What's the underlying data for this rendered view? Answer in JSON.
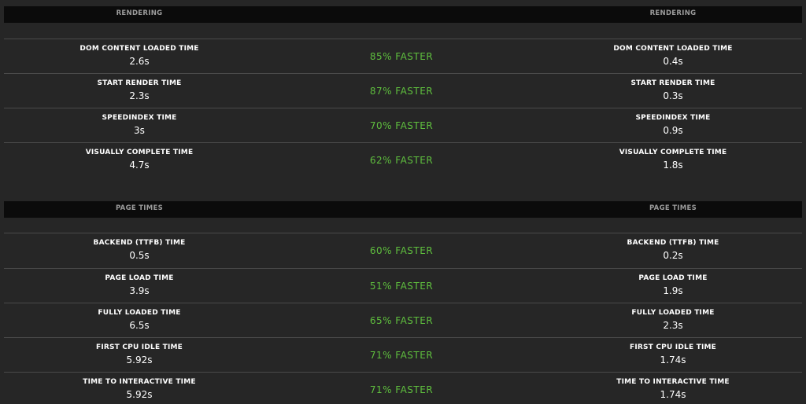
{
  "rendering": {
    "header_left": "RENDERING",
    "header_right": "RENDERING",
    "rows": [
      {
        "label": "DOM CONTENT LOADED TIME",
        "before": "2.6s",
        "after": "0.4s",
        "delta": "85% FASTER"
      },
      {
        "label": "START RENDER TIME",
        "before": "2.3s",
        "after": "0.3s",
        "delta": "87% FASTER"
      },
      {
        "label": "SPEEDINDEX TIME",
        "before": "3s",
        "after": "0.9s",
        "delta": "70% FASTER"
      },
      {
        "label": "VISUALLY COMPLETE TIME",
        "before": "4.7s",
        "after": "1.8s",
        "delta": "62% FASTER"
      }
    ]
  },
  "page_times": {
    "header_left": "PAGE TIMES",
    "header_right": "PAGE TIMES",
    "rows": [
      {
        "label": "BACKEND (TTFB) TIME",
        "before": "0.5s",
        "after": "0.2s",
        "delta": "60% FASTER"
      },
      {
        "label": "PAGE LOAD TIME",
        "before": "3.9s",
        "after": "1.9s",
        "delta": "51% FASTER"
      },
      {
        "label": "FULLY LOADED TIME",
        "before": "6.5s",
        "after": "2.3s",
        "delta": "65% FASTER"
      },
      {
        "label": "FIRST CPU IDLE TIME",
        "before": "5.92s",
        "after": "1.74s",
        "delta": "71% FASTER"
      },
      {
        "label": "TIME TO INTERACTIVE TIME",
        "before": "5.92s",
        "after": "1.74s",
        "delta": "71% FASTER"
      }
    ]
  },
  "colors": {
    "background": "#262626",
    "header_bar": "#0b0b0b",
    "header_text": "#9c9c9c",
    "faster_green": "#5fbf3e",
    "divider": "#4a4a4a"
  }
}
